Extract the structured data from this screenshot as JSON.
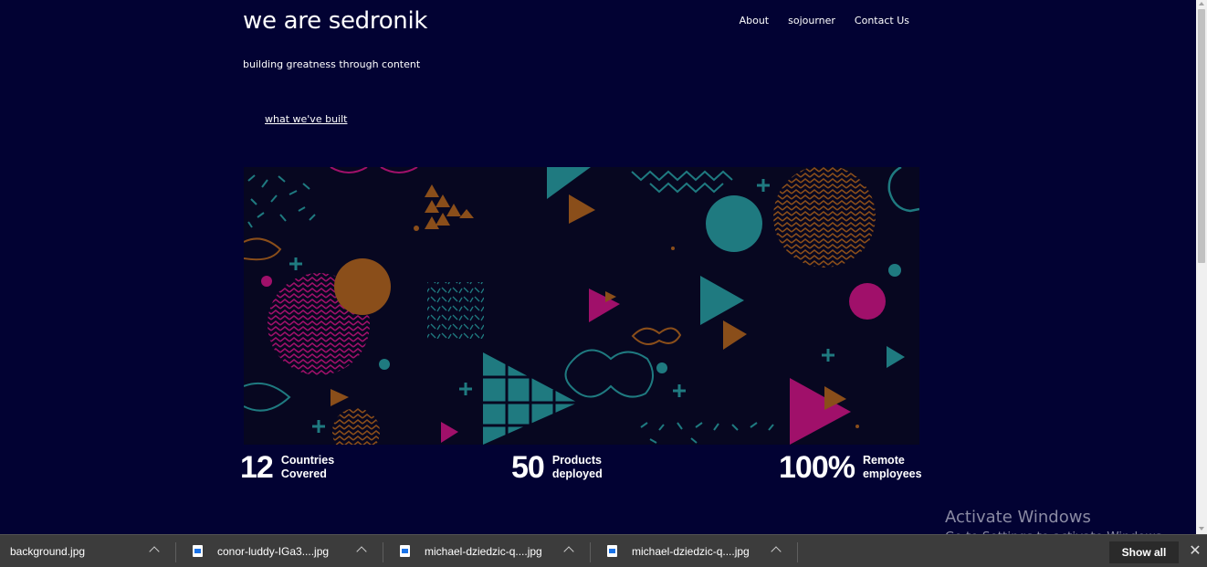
{
  "site": {
    "title": "we are sedronik",
    "tagline": "building greatness through content",
    "cta": "what we've built"
  },
  "nav": {
    "items": [
      "About",
      "sojourner",
      "Contact Us"
    ]
  },
  "hero": {
    "icon": "geometric-pattern-image"
  },
  "stats": [
    {
      "value": "12",
      "label_line1": "Countries",
      "label_line2": "Covered"
    },
    {
      "value": "50",
      "label_line1": "Products",
      "label_line2": "deployed"
    },
    {
      "value": "100%",
      "label_line1": "Remote",
      "label_line2": "employees"
    }
  ],
  "watermark": {
    "title": "Activate Windows",
    "subtitle": "Go to Settings to activate Windows."
  },
  "downloads": {
    "items": [
      "background.jpg",
      "conor-luddy-IGa3....jpg",
      "michael-dziedzic-q....jpg",
      "michael-dziedzic-q....jpg"
    ],
    "show_all": "Show all",
    "close": "✕"
  },
  "colors": {
    "page_bg": "#020233",
    "teal": "#1f7a80",
    "magenta": "#a0106a",
    "orange": "#8a4e1a"
  }
}
